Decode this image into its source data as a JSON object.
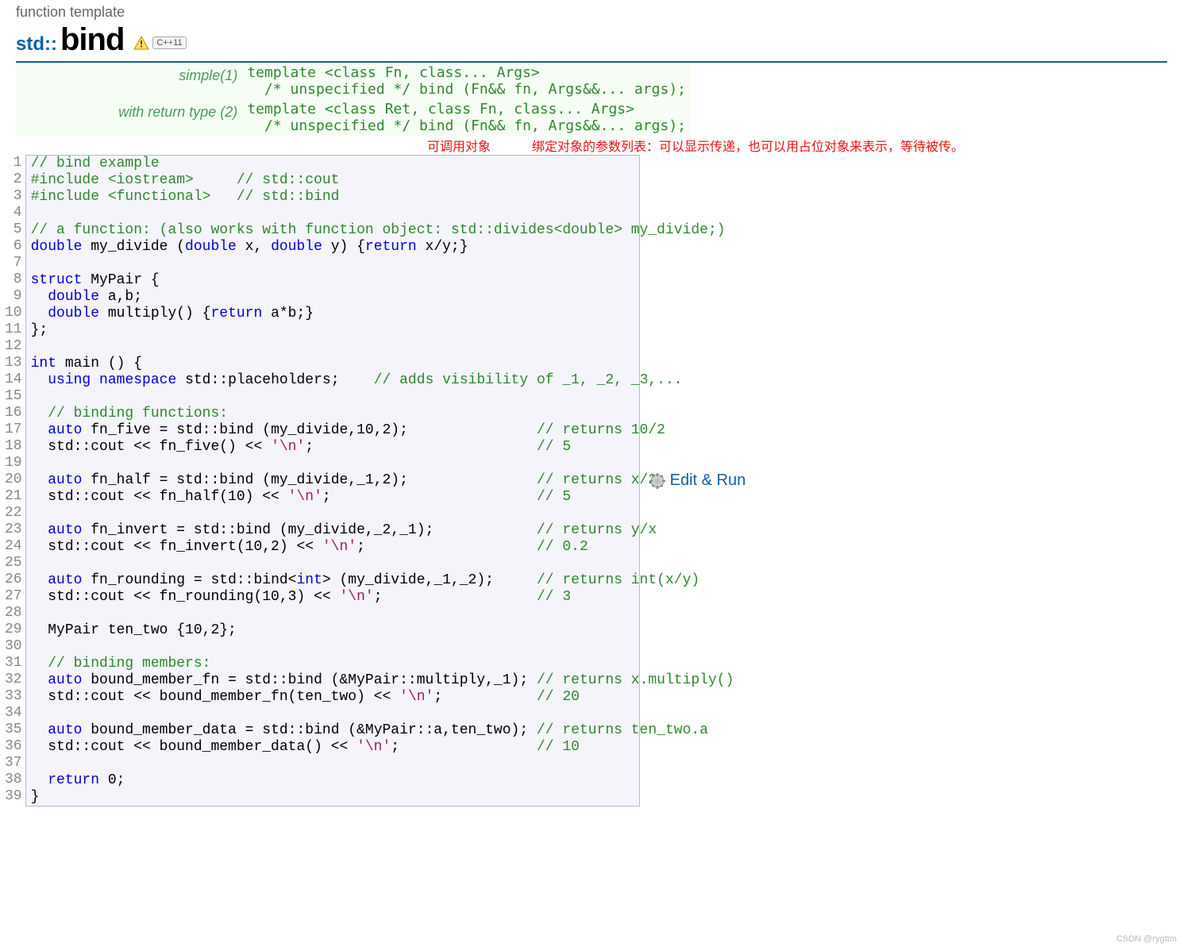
{
  "subtitle": "function template",
  "namespace": "std::",
  "title": "bind",
  "badge_cxx": "C++11",
  "signatures": [
    {
      "label": "simple(1)",
      "body": "template <class Fn, class... Args>\n  /* unspecified */ bind (Fn&& fn, Args&&... args);"
    },
    {
      "label": "with return type (2)",
      "body": "template <class Ret, class Fn, class... Args>\n  /* unspecified */ bind (Fn&& fn, Args&&... args);"
    }
  ],
  "annotations": {
    "a1": "可调用对象",
    "a2": "绑定对象的参数列表：可以显示传递，也可以用占位对象来表示，等待被传。"
  },
  "code": {
    "line_count": 39,
    "l1": "// bind example",
    "l2a": "#include <iostream>",
    "l2b": "// std::cout",
    "l3a": "#include <functional>",
    "l3b": "// std::bind",
    "l5": "// a function: (also works with function object: std::divides<double> my_divide;)",
    "l6a": "double",
    "l6b": " my_divide (",
    "l6c": "double",
    "l6d": " x, ",
    "l6e": "double",
    "l6f": " y) {",
    "l6g": "return",
    "l6h": " x/y;}",
    "l8a": "struct",
    "l8b": " MyPair {",
    "l9a": "  ",
    "l9b": "double",
    "l9c": " a,b;",
    "l10a": "  ",
    "l10b": "double",
    "l10c": " multiply() {",
    "l10d": "return",
    "l10e": " a*b;}",
    "l11": "};",
    "l13a": "int",
    "l13b": " main () {",
    "l14a": "  ",
    "l14b": "using",
    "l14c": " ",
    "l14d": "namespace",
    "l14e": " std::placeholders;    ",
    "l14f": "// adds visibility of _1, _2, _3,...",
    "l16": "  // binding functions:",
    "l17a": "  ",
    "l17b": "auto",
    "l17c": " fn_five = std::bind (my_divide,10,2);               ",
    "l17d": "// returns 10/2",
    "l18a": "  std::cout << fn_five() << ",
    "l18b": "'\\n'",
    "l18c": ";                          ",
    "l18d": "// 5",
    "l20a": "  ",
    "l20b": "auto",
    "l20c": " fn_half = std::bind (my_divide,_1,2);               ",
    "l20d": "// returns x/2",
    "l21a": "  std::cout << fn_half(10) << ",
    "l21b": "'\\n'",
    "l21c": ";                        ",
    "l21d": "// 5",
    "l23a": "  ",
    "l23b": "auto",
    "l23c": " fn_invert = std::bind (my_divide,_2,_1);            ",
    "l23d": "// returns y/x",
    "l24a": "  std::cout << fn_invert(10,2) << ",
    "l24b": "'\\n'",
    "l24c": ";                    ",
    "l24d": "// 0.2",
    "l26a": "  ",
    "l26b": "auto",
    "l26c": " fn_rounding = std::bind<",
    "l26d": "int",
    "l26e": "> (my_divide,_1,_2);     ",
    "l26f": "// returns int(x/y)",
    "l27a": "  std::cout << fn_rounding(10,3) << ",
    "l27b": "'\\n'",
    "l27c": ";                  ",
    "l27d": "// 3",
    "l29": "  MyPair ten_two {10,2};",
    "l31": "  // binding members:",
    "l32a": "  ",
    "l32b": "auto",
    "l32c": " bound_member_fn = std::bind (&MyPair::multiply,_1); ",
    "l32d": "// returns x.multiply()",
    "l33a": "  std::cout << bound_member_fn(ten_two) << ",
    "l33b": "'\\n'",
    "l33c": ";           ",
    "l33d": "// 20",
    "l35a": "  ",
    "l35b": "auto",
    "l35c": " bound_member_data = std::bind (&MyPair::a,ten_two); ",
    "l35d": "// returns ten_two.a",
    "l36a": "  std::cout << bound_member_data() << ",
    "l36b": "'\\n'",
    "l36c": ";                ",
    "l36d": "// 10",
    "l38a": "  ",
    "l38b": "return",
    "l38c": " 0;",
    "l39": "}"
  },
  "edit_run_label": "Edit & Run",
  "watermark": "CSDN @rygttm"
}
